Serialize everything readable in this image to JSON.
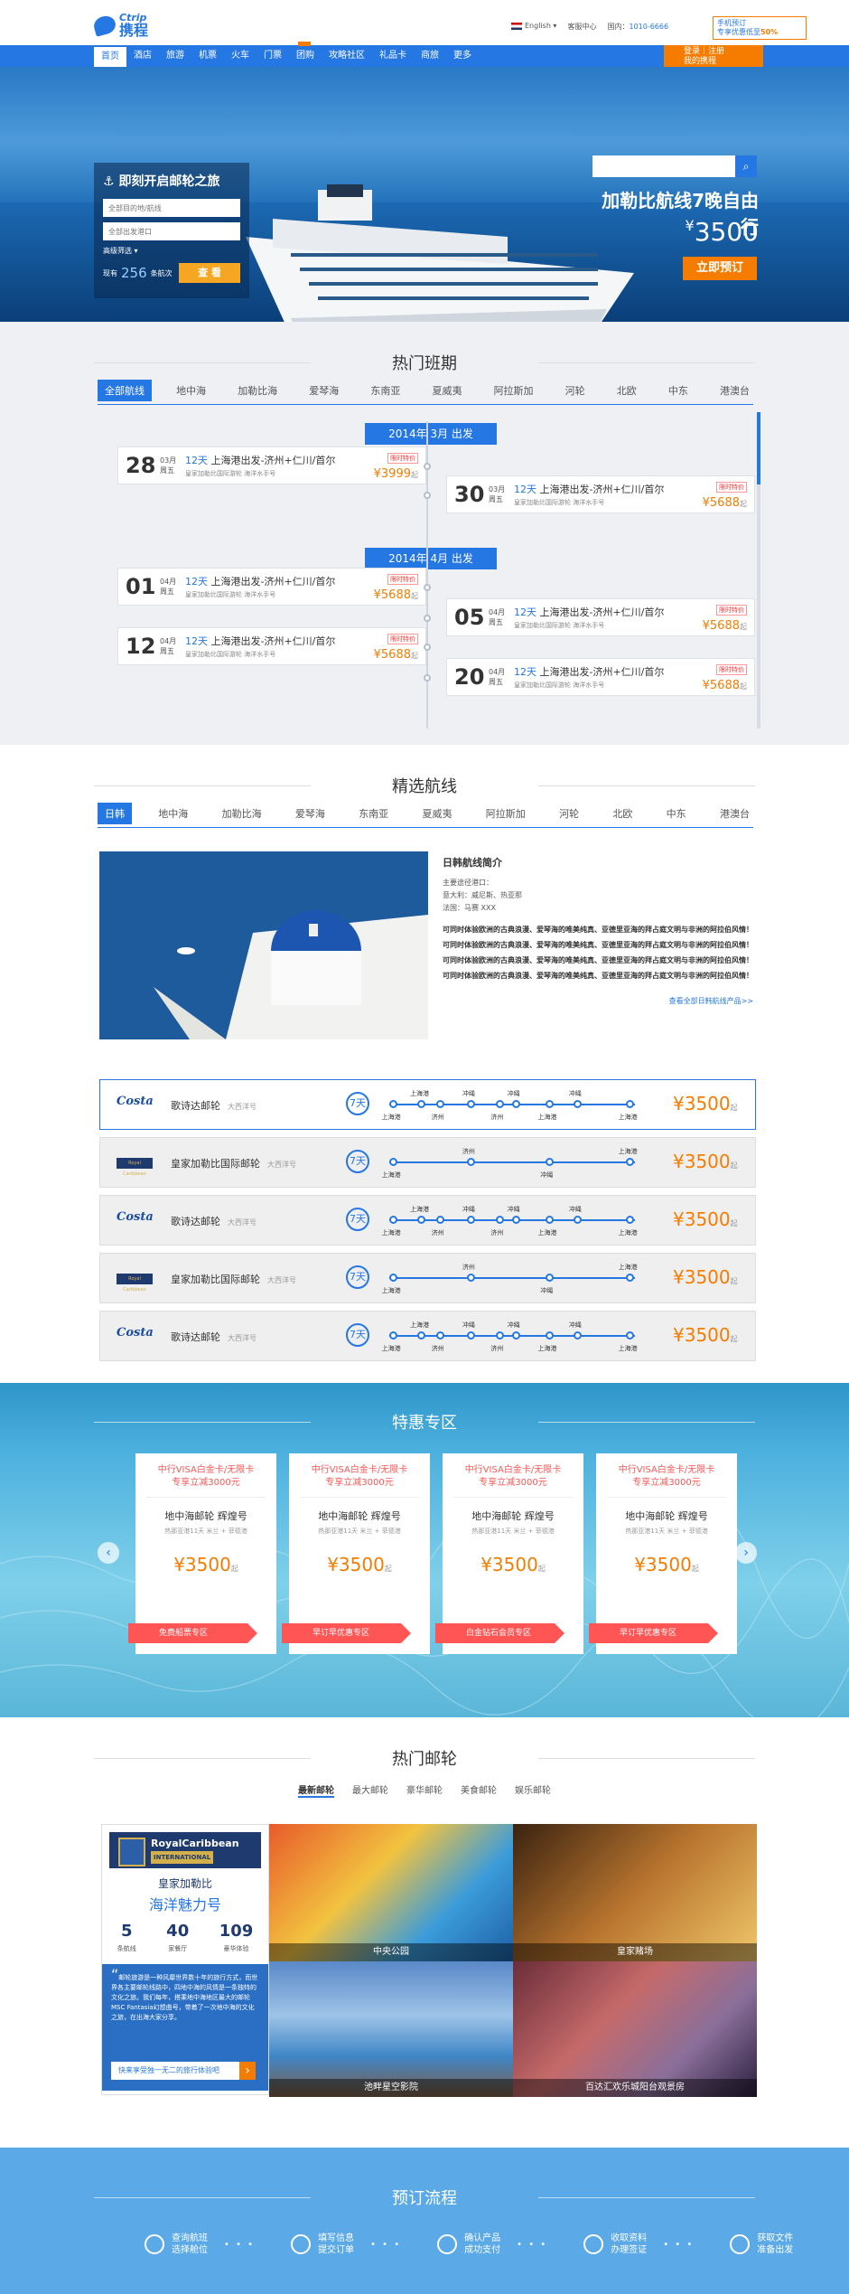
{
  "header": {
    "logo_en": "Ctrip",
    "logo_cn": "携程",
    "lang": "English",
    "user_center": "客服中心",
    "phone_label": "国内：",
    "phone": "1010-6666",
    "promo_line1": "手机预订",
    "promo_line2": "专享优惠低至",
    "promo_pct": "50%"
  },
  "nav": {
    "items": [
      "首页",
      "酒店",
      "旅游",
      "机票",
      "火车",
      "门票",
      "团购",
      "攻略社区",
      "礼品卡",
      "商旅",
      "更多"
    ],
    "login1": "登录｜注册",
    "login2": "我的携程"
  },
  "hero": {
    "search_title": "即刻开启邮轮之旅",
    "dest_placeholder": "全部目的地/航线",
    "port_placeholder": "全部出发港口",
    "more": "高级筛选",
    "count_pre": "现有",
    "count": "256",
    "count_suf": "条航次",
    "search_btn": "查 看",
    "headline": "加勒比航线7晚自由行",
    "price_sym": "¥",
    "price": "3500",
    "book": "立即预订"
  },
  "hot": {
    "title": "热门班期",
    "tabs": [
      "全部航线",
      "地中海",
      "加勒比海",
      "爱琴海",
      "东南亚",
      "夏威夷",
      "阿拉斯加",
      "河轮",
      "北欧",
      "中东",
      "港澳台"
    ],
    "months": [
      "2014年 3月 出发",
      "2014年 4月 出发"
    ],
    "cards": [
      {
        "day": "28",
        "month": "03月",
        "week": "周五",
        "days": "12天",
        "route": "上海港出发-济州+仁川/首尔",
        "ship": "皇家加勒比国际游轮  海洋水手号",
        "tag": "限时特价",
        "price": "¥3999",
        "unit": "起"
      },
      {
        "day": "30",
        "month": "03月",
        "week": "周五",
        "days": "12天",
        "route": "上海港出发-济州+仁川/首尔",
        "ship": "皇家加勒比国际游轮  海洋水手号",
        "tag": "限时特价",
        "price": "¥5688",
        "unit": "起"
      },
      {
        "day": "01",
        "month": "04月",
        "week": "周五",
        "days": "12天",
        "route": "上海港出发-济州+仁川/首尔",
        "ship": "皇家加勒比国际游轮  海洋水手号",
        "tag": "限时特价",
        "price": "¥5688",
        "unit": "起"
      },
      {
        "day": "05",
        "month": "04月",
        "week": "周五",
        "days": "12天",
        "route": "上海港出发-济州+仁川/首尔",
        "ship": "皇家加勒比国际游轮  海洋水手号",
        "tag": "限时特价",
        "price": "¥5688",
        "unit": "起"
      },
      {
        "day": "12",
        "month": "04月",
        "week": "周五",
        "days": "12天",
        "route": "上海港出发-济州+仁川/首尔",
        "ship": "皇家加勒比国际游轮  海洋水手号",
        "tag": "限时特价",
        "price": "¥5688",
        "unit": "起"
      },
      {
        "day": "20",
        "month": "04月",
        "week": "周五",
        "days": "12天",
        "route": "上海港出发-济州+仁川/首尔",
        "ship": "皇家加勒比国际游轮  海洋水手号",
        "tag": "限时特价",
        "price": "¥5688",
        "unit": "起"
      }
    ]
  },
  "feat": {
    "title": "精选航线",
    "tabs": [
      "日韩",
      "地中海",
      "加勒比海",
      "爱琴海",
      "东南亚",
      "夏威夷",
      "阿拉斯加",
      "河轮",
      "北欧",
      "中东",
      "港澳台"
    ],
    "intro_title": "日韩航线简介",
    "intro_l1": "主要途径港口：",
    "intro_l2": "意大利：威尼斯、热亚那",
    "intro_l3": "法国：马赛 XXX",
    "intro_body": "可同时体验欧洲的古典浪漫、爱琴海的唯美纯真、亚德里亚海的拜占庭文明与非洲的阿拉伯风情！可同时体验欧洲的古典浪漫、爱琴海的唯美纯真、亚德里亚海的拜占庭文明与非洲的阿拉伯风情！可同时体验欧洲的古典浪漫、爱琴海的唯美纯真、亚德里亚海的拜占庭文明与非洲的阿拉伯风情！可同时体验欧洲的古典浪漫、爱琴海的唯美纯真、亚德里亚海的拜占庭文明与非洲的阿拉伯风情！",
    "more": "查看全部日韩航线产品>>",
    "routes": [
      {
        "logo": "Costa",
        "name": "歌诗达邮轮",
        "sea": "大西洋号",
        "days": "7天",
        "price": "¥3500",
        "unit": "起"
      },
      {
        "logo": "Royal Caribbean",
        "name": "皇家加勒比国际邮轮",
        "sea": "大西洋号",
        "days": "7天",
        "price": "¥3500",
        "unit": "起"
      },
      {
        "logo": "Costa",
        "name": "歌诗达邮轮",
        "sea": "大西洋号",
        "days": "7天",
        "price": "¥3500",
        "unit": "起"
      },
      {
        "logo": "Royal Caribbean",
        "name": "皇家加勒比国际邮轮",
        "sea": "大西洋号",
        "days": "7天",
        "price": "¥3500",
        "unit": "起"
      },
      {
        "logo": "Costa",
        "name": "歌诗达邮轮",
        "sea": "大西洋号",
        "days": "7天",
        "price": "¥3500",
        "unit": "起"
      }
    ],
    "ports": {
      "a": "上海港",
      "b": "济州",
      "c": "冲绳"
    }
  },
  "deals": {
    "title": "特惠专区",
    "cards": [
      {
        "h1": "中行VISA白金卡/无限卡",
        "h2": "专享立减3000元",
        "ship": "地中海邮轮  辉煌号",
        "sub": "热那亚港11天  米兰 + 菲德港",
        "price": "¥3500",
        "unit": "起",
        "band": "免费船票专区"
      },
      {
        "h1": "中行VISA白金卡/无限卡",
        "h2": "专享立减3000元",
        "ship": "地中海邮轮  辉煌号",
        "sub": "热那亚港11天  米兰 + 菲德港",
        "price": "¥3500",
        "unit": "起",
        "band": "早订早优惠专区"
      },
      {
        "h1": "中行VISA白金卡/无限卡",
        "h2": "专享立减3000元",
        "ship": "地中海邮轮  辉煌号",
        "sub": "热那亚港11天  米兰 + 菲德港",
        "price": "¥3500",
        "unit": "起",
        "band": "白金钻石会员专区"
      },
      {
        "h1": "中行VISA白金卡/无限卡",
        "h2": "专享立减3000元",
        "ship": "地中海邮轮  辉煌号",
        "sub": "热那亚港11天  米兰 + 菲德港",
        "price": "¥3500",
        "unit": "起",
        "band": "早订早优惠专区"
      }
    ]
  },
  "ships": {
    "title": "热门邮轮",
    "tabs": [
      "最新邮轮",
      "最大邮轮",
      "豪华邮轮",
      "美食邮轮",
      "娱乐邮轮"
    ],
    "brand1": "RoyalCaribbean",
    "brand2": "INTERNATIONAL",
    "name1": "皇家加勒比",
    "name2": "海洋魅力号",
    "stats": [
      {
        "n": "5",
        "l": "条航线"
      },
      {
        "n": "40",
        "l": "家餐厅"
      },
      {
        "n": "109",
        "l": "豪华体验"
      }
    ],
    "desc": "邮轮旅游是一种风靡世界数十年的旅行方式，而世界各主要邮轮线路中，四地中海的风情是一条独特的文化之旅。我们每年，搭乘地中海地区最大的邮轮MSC Fantasia幻想曲号，带着了一次地中海的文化之旅，在出海大家分享。",
    "go": "快来享受独一无二的旅行体验吧",
    "tiles": [
      "中央公园",
      "皇家赌场",
      "池畔星空影院",
      "百达汇欢乐城阳台观景房"
    ]
  },
  "flow": {
    "title": "预订流程",
    "steps": [
      {
        "a": "查询航班",
        "b": "选择舱位"
      },
      {
        "a": "填写信息",
        "b": "提交订单"
      },
      {
        "a": "确认产品",
        "b": "成功支付"
      },
      {
        "a": "收取资料",
        "b": "办理签证"
      },
      {
        "a": "获取文件",
        "b": "准备出发"
      }
    ]
  }
}
